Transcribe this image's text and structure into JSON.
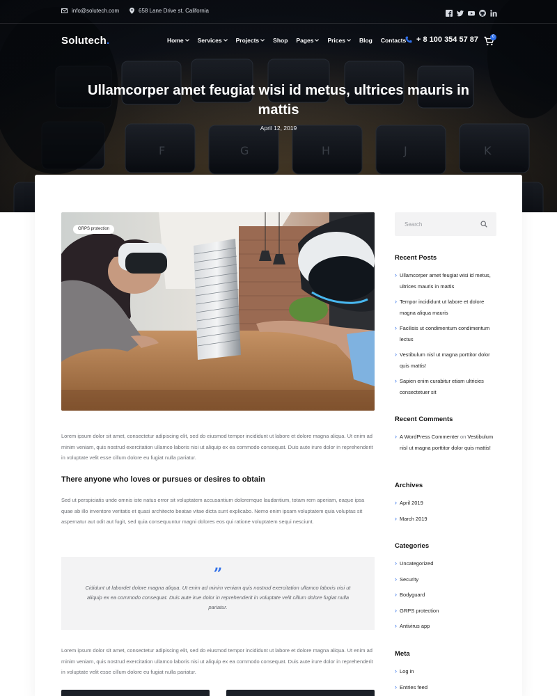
{
  "topbar": {
    "email": "info@solutech.com",
    "address": "658 Lane Drive st. California",
    "socials": [
      "facebook-icon",
      "twitter-icon",
      "youtube-icon",
      "github-icon",
      "linkedin-icon"
    ]
  },
  "header": {
    "logo": "Solutech",
    "logo_dot": ".",
    "menu": [
      {
        "label": "Home",
        "has_dropdown": true
      },
      {
        "label": "Services",
        "has_dropdown": true
      },
      {
        "label": "Projects",
        "has_dropdown": true
      },
      {
        "label": "Shop",
        "has_dropdown": false
      },
      {
        "label": "Pages",
        "has_dropdown": true
      },
      {
        "label": "Prices",
        "has_dropdown": true
      },
      {
        "label": "Blog",
        "has_dropdown": false
      },
      {
        "label": "Contacts",
        "has_dropdown": false
      }
    ],
    "phone": "+ 8 100 354 57 87",
    "cart_count": "0"
  },
  "post": {
    "title": "Ullamcorper amet feugiat wisi id metus, ultrices mauris in mattis",
    "date": "April 12, 2019",
    "image_tag": "GRPS protection",
    "paragraph_1": "Lorem ipsum dolor sit amet, consectetur adipiscing elit, sed do eiusmod tempor incididunt ut labore et dolore magna aliqua. Ut enim ad minim veniam, quis nostrud exercitation ullamco laboris nisi ut aliquip ex ea commodo consequat. Duis aute irure dolor in reprehenderit in voluptate velit esse cillum dolore eu fugiat nulla pariatur.",
    "heading": "There anyone who loves or pursues or desires to obtain",
    "paragraph_2": "Sed ut perspiciatis unde omnis iste natus error sit voluptatem accusantium doloremque laudantium, totam rem aperiam, eaque ipsa quae ab illo inventore veritatis et quasi architecto beatae vitae dicta sunt explicabo. Nemo enim ipsam voluptatem quia voluptas sit aspernatur aut odit aut fugit, sed quia consequuntur magni dolores eos qui ratione voluptatem sequi nesciunt.",
    "quote_mark": "”",
    "quote": "Cididunt ut labordet dolore magna aliqua. Ut enim ad minim veniam quis nostrud exercitation ullamco laboris nisi ut aliquip ex ea commodo consequat. Duis aute irue dolor in reprehenderit in voluptate velit cillum dolore fugiat nulla pariatur.",
    "paragraph_3": "Lorem ipsum dolor sit amet, consectetur adipiscing elit, sed do eiusmod tempor incididunt ut labore et dolore magna aliqua. Ut enim ad minim veniam, quis nostrud exercitation ullamco laboris nisi ut aliquip ex ea commodo consequat. Duis aute irure dolor in reprehenderit in voluptate velit esse cillum dolore eu fugiat nulla pariatur."
  },
  "sidebar": {
    "search_placeholder": "Search",
    "recent_posts_title": "Recent Posts",
    "recent_posts": [
      "Ullamcorper amet feugiat wisi id metus, ultrices mauris in mattis",
      "Tempor incididunt ut labore et dolore magna aliqua mauris",
      "Facilisis ut condimentum condimentum lectus",
      "Vestibulum nisl ut magna porttitor dolor quis mattis!",
      "Sapien enim curabitur etiam ultricies consectetuer sit"
    ],
    "recent_comments_title": "Recent Comments",
    "comment_author": "A WordPress Commenter",
    "comment_on": "on",
    "comment_post": "Vestibulum nisl ut magna porttitor dolor quis mattis!",
    "archives_title": "Archives",
    "archives": [
      "April 2019",
      "March 2019"
    ],
    "categories_title": "Categories",
    "categories": [
      "Uncategorized",
      "Security",
      "Bodyguard",
      "GRPS protection",
      "Antivirus app"
    ],
    "meta_title": "Meta",
    "meta": [
      "Log in",
      "Entries feed"
    ]
  },
  "colors": {
    "accent": "#2f6fe8",
    "hero_dark": "#0b0e14",
    "quote_bg": "#f3f3f4"
  }
}
